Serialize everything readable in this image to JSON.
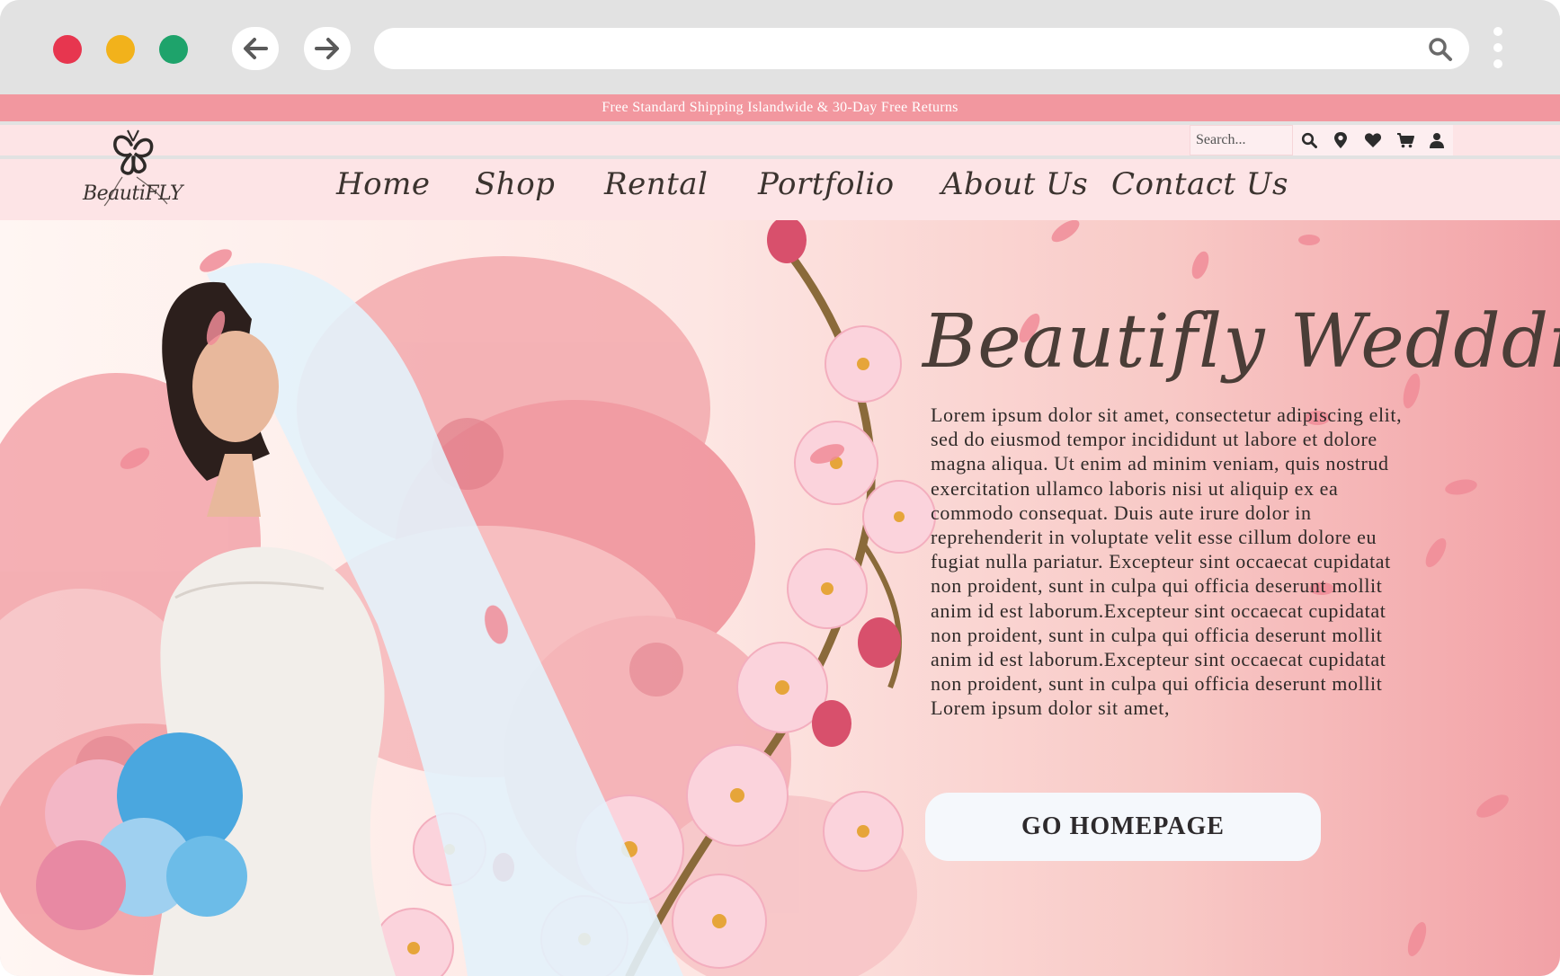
{
  "browser": {
    "address_text": "",
    "icons": [
      "arrow-left-icon",
      "arrow-right-icon",
      "search-icon",
      "kebab-menu-icon"
    ]
  },
  "promo": {
    "text": "Free Standard Shipping Islandwide & 30-Day Free Returns"
  },
  "header": {
    "logo_text": "BeautiFLY",
    "search_placeholder": "Search...",
    "util_icons": [
      "search-icon",
      "location-pin-icon",
      "heart-icon",
      "cart-icon",
      "user-icon"
    ],
    "nav": [
      "Home",
      "Shop",
      "Rental",
      "Portfolio",
      "About Us",
      "Contact Us"
    ]
  },
  "hero": {
    "title": "Beautifly Weddding",
    "body": "Lorem ipsum dolor sit amet, consectetur adipiscing elit, sed do eiusmod tempor incididunt ut labore et dolore magna aliqua. Ut enim ad minim veniam, quis nostrud exercitation ullamco laboris nisi ut aliquip ex ea commodo consequat. Duis aute irure dolor in reprehenderit in voluptate velit esse cillum dolore eu fugiat nulla pariatur. Excepteur sint occaecat cupidatat non proident, sunt in culpa qui officia deserunt mollit anim id est laborum.Excepteur sint occaecat cupidatat non proident, sunt in culpa qui officia deserunt mollit anim id est laborum.Excepteur sint occaecat cupidatat non proident, sunt in culpa qui officia deserunt mollit Lorem ipsum dolor sit amet,",
    "cta_label": "GO HOMEPAGE"
  },
  "colors": {
    "promo_bg": "#f2979f",
    "header_bg": "#fde4e6",
    "text_dark": "#4a3d37",
    "petal_pink": "#f4a6b4",
    "close_red": "#e7364f",
    "minimize_yellow": "#f2b21b",
    "maximize_green": "#1ea36b"
  }
}
